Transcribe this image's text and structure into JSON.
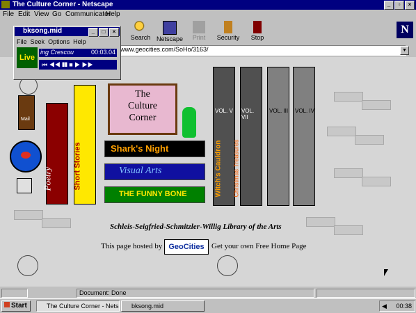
{
  "window": {
    "title": "The Culture Corner - Netscape"
  },
  "menu": [
    "File",
    "Edit",
    "View",
    "Go",
    "Communicator",
    "Help"
  ],
  "toolbar": {
    "search": "Search",
    "netscape": "Netscape",
    "print": "Print",
    "security": "Security",
    "stop": "Stop"
  },
  "location": {
    "url": "www.geocities.com/SoHo/3163/"
  },
  "player": {
    "title": "bkmid",
    "title_full": "bksong.mid",
    "menu": [
      "File",
      "Seek",
      "Options",
      "Help"
    ],
    "track_text": "ing  Crescou",
    "time": "00:03.04",
    "logo": "Live"
  },
  "page": {
    "sign": [
      "The",
      "Culture",
      "Corner"
    ],
    "buttons": [
      "Shark's Night",
      "Visual Arts",
      "The Funny Bone"
    ],
    "poetry": "Poetry",
    "short_stories": "Short Stories",
    "books": [
      {
        "vol": "VOL. V",
        "title": "Witch's Cauldron"
      },
      {
        "vol": "VOL. VII",
        "title": "Christmas Treasures"
      },
      {
        "vol": "VOL. III",
        "title": ""
      },
      {
        "vol": "VOL. IV",
        "title": ""
      }
    ],
    "library": "Schleis-Seigfried-Schmitzler-Willig Library of the Arts",
    "hosted": "This page hosted by",
    "geocities": "GeoCities",
    "free_page": "Get your own Free Home Page",
    "mail": "Mail"
  },
  "status": {
    "text": "Document: Done"
  },
  "taskbar": {
    "start": "Start",
    "task1": "The Culture Corner - Netsc...",
    "task2": "bksong.mid",
    "clock": "00:38"
  },
  "colors": {
    "titlebar": "#000080",
    "sign_pink": "#e8b8d0",
    "shark_bg": "#000000",
    "visual_bg": "#1010a0",
    "funny_bg": "#008000"
  }
}
